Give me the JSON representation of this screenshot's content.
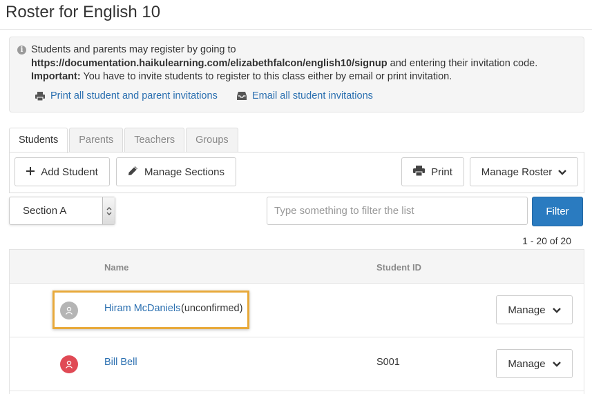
{
  "page": {
    "title": "Roster for English 10"
  },
  "info": {
    "icon": "info-icon",
    "text_prefix": "Students and parents may register by going to ",
    "signup_url": "https://documentation.haikulearning.com/elizabethfalcon/english10/signup",
    "text_middle": " and entering their invitation code. ",
    "important_label": "Important:",
    "text_suffix": " You have to invite students to register to this class either by email or print invitation.",
    "print_link": "Print all student and parent invitations",
    "email_link": "Email all student invitations"
  },
  "tabs": [
    {
      "label": "Students",
      "active": true
    },
    {
      "label": "Parents",
      "active": false
    },
    {
      "label": "Teachers",
      "active": false
    },
    {
      "label": "Groups",
      "active": false
    }
  ],
  "toolbar": {
    "add_student": "Add Student",
    "manage_sections": "Manage Sections",
    "print": "Print",
    "manage_roster": "Manage Roster"
  },
  "filter": {
    "section_selected": "Section A",
    "placeholder": "Type something to filter the list",
    "button": "Filter"
  },
  "pager": {
    "text": "1 - 20 of 20"
  },
  "table": {
    "headers": {
      "name": "Name",
      "student_id": "Student ID"
    },
    "rows": [
      {
        "name": "Hiram McDaniels",
        "note": "(unconfirmed)",
        "student_id": "",
        "avatar_color": "#b5b5b5",
        "manage": "Manage"
      },
      {
        "name": "Bill Bell",
        "note": "",
        "student_id": "S001",
        "avatar_color": "#e04a55",
        "manage": "Manage"
      }
    ]
  },
  "colors": {
    "link": "#2a6fb0",
    "primary_button": "#2a7bc0",
    "highlight": "#e8a93a"
  }
}
